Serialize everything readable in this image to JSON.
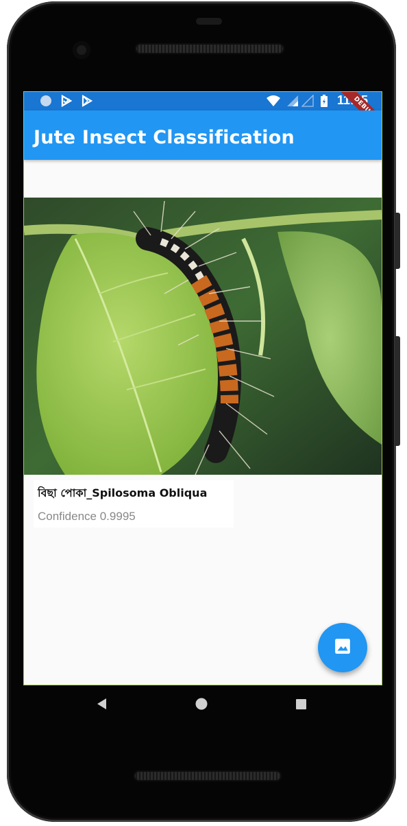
{
  "status_bar": {
    "time": "11:55",
    "icons": [
      "circle-notification-icon",
      "play-protect-icon",
      "play-store-icon",
      "wifi-icon",
      "cell-signal-icon",
      "cell-signal-empty-icon",
      "battery-charging-icon"
    ]
  },
  "debug_banner": "DEBUG",
  "app_bar": {
    "title": "Jute Insect Classification"
  },
  "result": {
    "label": "বিছা পোকা_Spilosoma Obliqua",
    "confidence_text": "Confidence 0.9995"
  },
  "fab": {
    "icon": "image-icon"
  },
  "nav_bar": {
    "icons": [
      "back-icon",
      "home-icon",
      "recents-icon"
    ]
  },
  "colors": {
    "status_bar": "#1976d2",
    "app_bar": "#2196f3",
    "fab": "#2196f3",
    "debug_banner": "#a62828"
  }
}
